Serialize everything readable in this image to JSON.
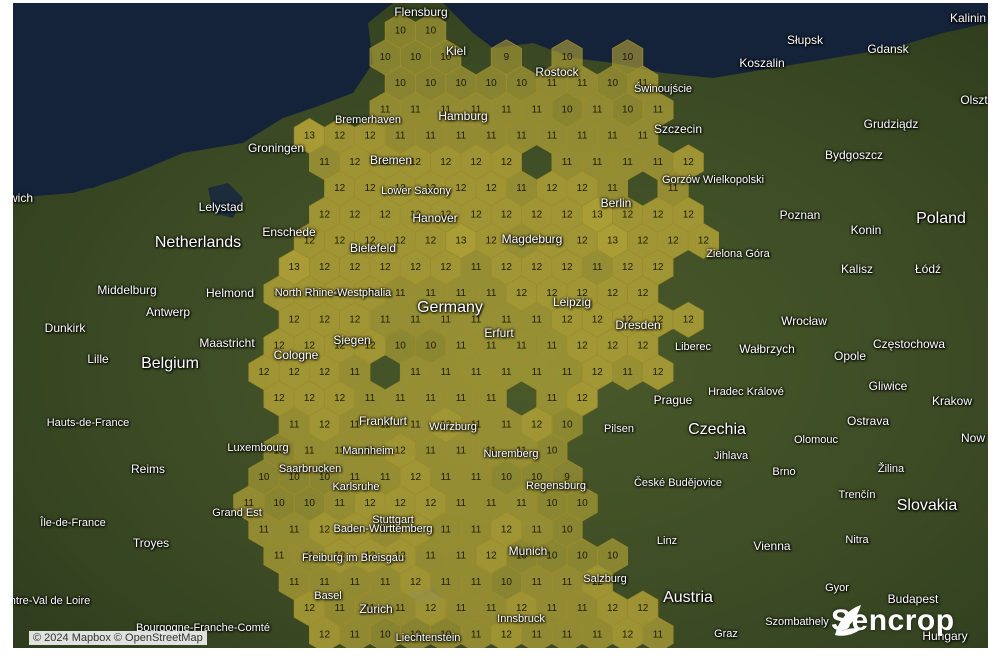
{
  "map": {
    "attribution": "© 2024 Mapbox © OpenStreetMap",
    "logo_text": "Sencrop",
    "colors": {
      "hex_fill": "#c7b23b",
      "hex_stroke": "#9a8a2a",
      "land": "#3a4a22",
      "sea": "#15233a"
    },
    "countries": [
      "Netherlands",
      "Belgium",
      "Germany",
      "Poland",
      "Czechia",
      "Austria",
      "Slovakia"
    ],
    "cities": [
      "Flensburg",
      "Kiel",
      "Rostock",
      "Świnoujście",
      "Słupsk",
      "Gdansk",
      "Kalinin",
      "Koszalin",
      "Olszt",
      "Szczecin",
      "Grudziądz",
      "Bydgoszcz",
      "Gorzów Wielkopolski",
      "Poznan",
      "Konin",
      "Kalisz",
      "Łódź",
      "Zielona Góra",
      "Wrocław",
      "Wałbrzych",
      "Opole",
      "Częstochowa",
      "Gliwice",
      "Krakow",
      "Ostrava",
      "Now",
      "Hamburg",
      "Bremerhaven",
      "Bremen",
      "Groningen",
      "Lower Saxony",
      "Hanover",
      "Berlin",
      "Magdeburg",
      "Bielefeld",
      "Enschede",
      "North Rhine-Westphalia",
      "Leipzig",
      "Dresden",
      "Erfurt",
      "Siegen",
      "Cologne",
      "Liberec",
      "Prague",
      "Hradec Králové",
      "Olomouc",
      "Pilsen",
      "Jihlava",
      "Brno",
      "Žilina",
      "České Budějovice",
      "Trenčín",
      "Frankfurt",
      "Mannheim",
      "Würzburg",
      "Nuremberg",
      "Regensburg",
      "Saarbrucken",
      "Karlsruhe",
      "Stuttgart",
      "Baden-Württemberg",
      "Munich",
      "Linz",
      "Salzburg",
      "Vienna",
      "Nitra",
      "Gyor",
      "Budapest",
      "Szombathely",
      "Hungary",
      "Graz",
      "Innsbruck",
      "Liechtenstein",
      "Zurich",
      "Basel",
      "Freiburg im Breisgau",
      "Lelystad",
      "Middelburg",
      "Antwerp",
      "Helmond",
      "Maastricht",
      "Dunkirk",
      "Lille",
      "Hauts-de-France",
      "Reims",
      "Luxembourg",
      "Grand Est",
      "Troyes",
      "Île-de-France",
      "Bourgogne-Franche-Comté",
      "Centre-Val de Loire",
      "wich"
    ],
    "hexes": [
      [
        10,
        10,
        null,
        null,
        null,
        null,
        null,
        null,
        null,
        null,
        null,
        null,
        null,
        null,
        null,
        null
      ],
      [
        10,
        null,
        10,
        null,
        null,
        9,
        null,
        10,
        null,
        10,
        null,
        null,
        null,
        null,
        null,
        null
      ],
      [
        null,
        10,
        10,
        10,
        10,
        10,
        11,
        11,
        10,
        10,
        11,
        null,
        null,
        null,
        null,
        null
      ],
      [
        11,
        11,
        11,
        11,
        11,
        11,
        10,
        11,
        11,
        11,
        10,
        11,
        null,
        null,
        null,
        null
      ]
    ],
    "hex_values": [
      13,
      12,
      11,
      10,
      9
    ]
  }
}
